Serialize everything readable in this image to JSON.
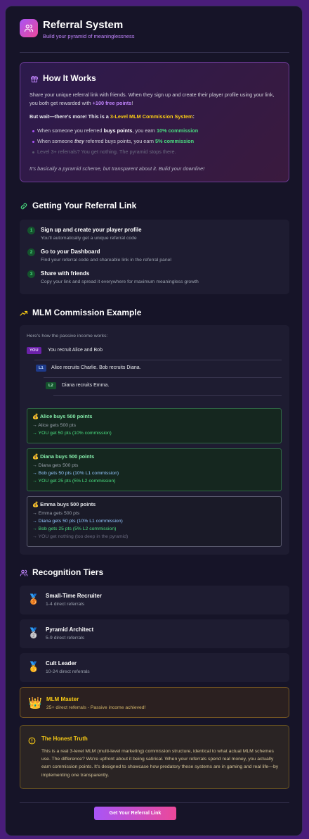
{
  "header": {
    "title": "Referral System",
    "subtitle": "Build your pyramid of meaninglessness",
    "icon": "users-icon"
  },
  "how_it_works": {
    "title": "How It Works",
    "p1_a": "Share your unique referral link with friends. When they sign up and create their player profile using your link, you both get rewarded with ",
    "p1_bonus": "+100 free points",
    "p1_b": "!",
    "p2_a": "But wait—there's more! This is a ",
    "p2_highlight": "3-Level MLM Commission System",
    "p2_b": ":",
    "bullet1_a": "When someone you referred ",
    "bullet1_bold": "buys points",
    "bullet1_b": ", you earn ",
    "bullet1_pct": "10% commission",
    "bullet2_a": "When someone ",
    "bullet2_they": "they",
    "bullet2_b": " referred buys points, you earn ",
    "bullet2_pct": "5% commission",
    "bullet3": "Level 3+ referrals? You get nothing. The pyramid stops there.",
    "footer": "It's basically a pyramid scheme, but transparent about it. Build your downline!"
  },
  "getting_link": {
    "title": "Getting Your Referral Link",
    "steps": [
      {
        "num": "1",
        "title": "Sign up and create your player profile",
        "desc": "You'll automatically get a unique referral code"
      },
      {
        "num": "2",
        "title": "Go to your Dashboard",
        "desc": "Find your referral code and shareable link in the referral panel"
      },
      {
        "num": "3",
        "title": "Share with friends",
        "desc": "Copy your link and spread it everywhere for maximum meaningless growth"
      }
    ]
  },
  "mlm_example": {
    "title": "MLM Commission Example",
    "intro": "Here's how the passive income works:",
    "tree": [
      {
        "tag": "YOU",
        "text": "You recruit Alice and Bob"
      },
      {
        "tag": "L1",
        "text": "Alice recruits Charlie. Bob recruits Diana."
      },
      {
        "tag": "L2",
        "text": "Diana recruits Emma."
      }
    ],
    "boxes": [
      {
        "title": "💰 Alice buys 500 points",
        "lines": [
          "→ Alice gets 500 pts",
          "→ YOU get 50 pts (10% commission)"
        ]
      },
      {
        "title": "💰 Diana buys 500 points",
        "lines": [
          "→ Diana gets 500 pts",
          "→ Bob gets 50 pts (10% L1 commission)",
          "→ YOU get 25 pts (5% L2 commission)"
        ]
      },
      {
        "title": "💰 Emma buys 500 points",
        "lines": [
          "→ Emma gets 500 pts",
          "→ Diana gets 50 pts (10% L1 commission)",
          "→ Bob gets 25 pts (5% L2 commission)",
          "→ YOU get nothing (too deep in the pyramid)"
        ]
      }
    ]
  },
  "tiers": {
    "title": "Recognition Tiers",
    "items": [
      {
        "icon": "🥉",
        "name": "Small-Time Recruiter",
        "desc": "1-4 direct referrals"
      },
      {
        "icon": "🥈",
        "name": "Pyramid Architect",
        "desc": "5-9 direct referrals"
      },
      {
        "icon": "🥇",
        "name": "Cult Leader",
        "desc": "10-24 direct referrals"
      },
      {
        "icon": "👑",
        "name": "MLM Master",
        "desc": "25+ direct referrals - Passive income achieved!"
      }
    ]
  },
  "truth": {
    "title": "The Honest Truth",
    "body": "This is a real 3-level MLM (multi-level marketing) commission structure, identical to what actual MLM schemes use. The difference? We're upfront about it being satirical. When your referrals spend real money, you actually earn commission points. It's designed to showcase how predatory these systems are in gaming and real life—by implementing one transparently."
  },
  "cta": {
    "label": "Get Your Referral Link"
  }
}
